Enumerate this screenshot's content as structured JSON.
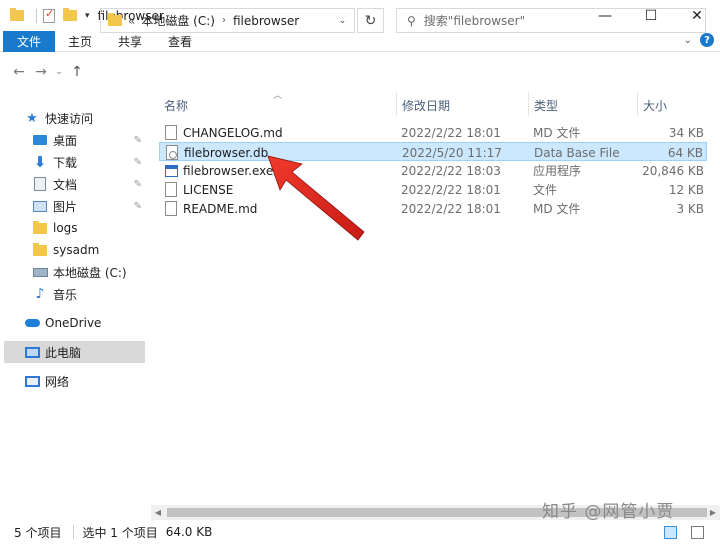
{
  "window": {
    "title": "filebrowser",
    "controls": {
      "minimize": "—",
      "maximize": "☐",
      "close": "✕"
    }
  },
  "ribbon": {
    "tabs": [
      {
        "label": "文件",
        "active": true
      },
      {
        "label": "主页"
      },
      {
        "label": "共享"
      },
      {
        "label": "查看"
      }
    ],
    "help": "?"
  },
  "address": {
    "prefix": "«",
    "crumbs": [
      "本地磁盘 (C:)",
      "filebrowser"
    ]
  },
  "search": {
    "placeholder": "搜索\"filebrowser\""
  },
  "nav": {
    "items": [
      {
        "label": "快速访问",
        "icon": "star-icon"
      },
      {
        "label": "桌面",
        "icon": "desktop-icon",
        "pinned": true
      },
      {
        "label": "下载",
        "icon": "download-icon",
        "pinned": true
      },
      {
        "label": "文档",
        "icon": "document-icon",
        "pinned": true
      },
      {
        "label": "图片",
        "icon": "picture-icon",
        "pinned": true
      },
      {
        "label": "logs",
        "icon": "folder-icon"
      },
      {
        "label": "sysadm",
        "icon": "folder-icon"
      },
      {
        "label": "本地磁盘 (C:)",
        "icon": "drive-icon"
      },
      {
        "label": "音乐",
        "icon": "music-icon"
      },
      {
        "label": "OneDrive",
        "icon": "cloud-icon"
      },
      {
        "label": "此电脑",
        "icon": "computer-icon",
        "selected": true
      },
      {
        "label": "网络",
        "icon": "network-icon"
      }
    ]
  },
  "columns": {
    "name": "名称",
    "date": "修改日期",
    "type": "类型",
    "size": "大小"
  },
  "files": [
    {
      "name": "CHANGELOG.md",
      "date": "2022/2/22 18:01",
      "type": "MD 文件",
      "size": "34 KB",
      "icon": "file-icon"
    },
    {
      "name": "filebrowser.db",
      "date": "2022/5/20 11:17",
      "type": "Data Base File",
      "size": "64 KB",
      "icon": "database-file-icon",
      "selected": true
    },
    {
      "name": "filebrowser.exe",
      "date": "2022/2/22 18:03",
      "type": "应用程序",
      "size": "20,846 KB",
      "icon": "exe-icon"
    },
    {
      "name": "LICENSE",
      "date": "2022/2/22 18:01",
      "type": "文件",
      "size": "12 KB",
      "icon": "file-icon"
    },
    {
      "name": "README.md",
      "date": "2022/2/22 18:01",
      "type": "MD 文件",
      "size": "3 KB",
      "icon": "file-icon"
    }
  ],
  "status": {
    "count": "5 个项目",
    "selected": "选中 1 个项目",
    "size": "64.0 KB"
  },
  "watermark": "知乎 @网管小贾",
  "colors": {
    "accent": "#1979ca",
    "selection": "#cce8ff",
    "arrow": "#e0201b"
  }
}
